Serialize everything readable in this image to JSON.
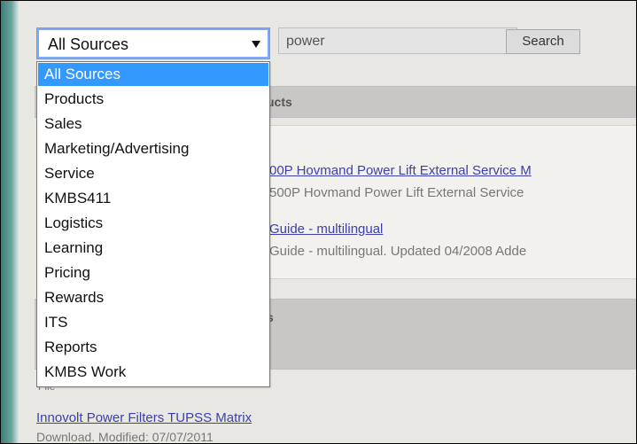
{
  "search": {
    "query": "power",
    "button_label": "Search"
  },
  "select": {
    "value": "All Sources",
    "options": [
      "All Sources",
      "Products",
      "Sales",
      "Marketing/Advertising",
      "Service",
      "KMBS411",
      "Logistics",
      "Learning",
      "Pricing",
      "Rewards",
      "ITS",
      "Reports",
      "KMBS Work"
    ]
  },
  "sections": {
    "products_title": "ucts",
    "results": [
      {
        "title": "00P Hovmand Power Lift External Service M",
        "desc": "500P Hovmand Power Lift External Service"
      },
      {
        "title": "Guide - multilingual",
        "desc": "Guide - multilingual. Updated 04/2008 Adde"
      }
    ],
    "second_title": "s",
    "file_label": "File",
    "bottom_link": "Innovolt Power Filters TUPSS Matrix",
    "bottom_desc": "Download. Modified: 07/07/2011"
  },
  "colors": {
    "teal": "#3a7f77",
    "selected": "#3399ff",
    "link": "#3b3fb0"
  }
}
